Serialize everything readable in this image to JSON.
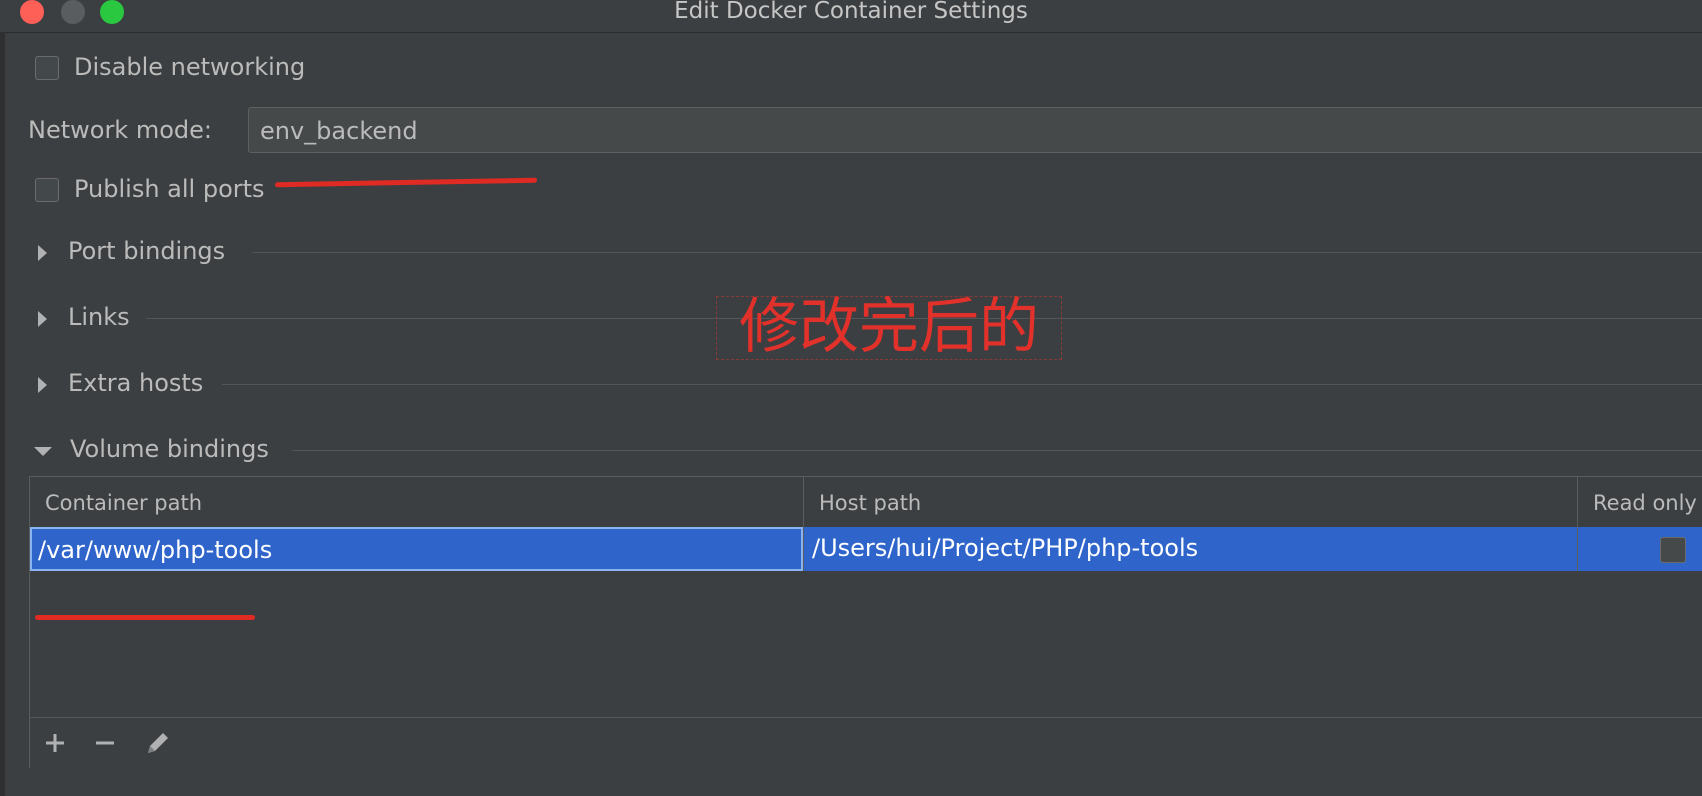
{
  "window": {
    "title": "Edit Docker Container Settings"
  },
  "options": {
    "disable_networking_label": "Disable networking",
    "disable_networking_checked": false,
    "network_mode_label": "Network mode:",
    "network_mode_value": "env_backend",
    "publish_all_ports_label": "Publish all ports",
    "publish_all_ports_checked": false
  },
  "sections": [
    {
      "label": "Port bindings",
      "expanded": false
    },
    {
      "label": "Links",
      "expanded": false
    },
    {
      "label": "Extra hosts",
      "expanded": false
    },
    {
      "label": "Volume bindings",
      "expanded": true
    }
  ],
  "volume_table": {
    "columns": [
      "Container path",
      "Host path",
      "Read only"
    ],
    "rows": [
      {
        "container_path": "/var/www/php-tools",
        "host_path": "/Users/hui/Project/PHP/php-tools",
        "read_only": false
      }
    ]
  },
  "toolbar": {
    "add_icon": "plus-icon",
    "remove_icon": "minus-icon",
    "edit_icon": "pencil-icon"
  },
  "annotation": {
    "text": "修改完后的",
    "color": "#e02a24"
  },
  "colors": {
    "selection": "#2f65ca",
    "background": "#3c3f41",
    "field": "#45494a"
  }
}
